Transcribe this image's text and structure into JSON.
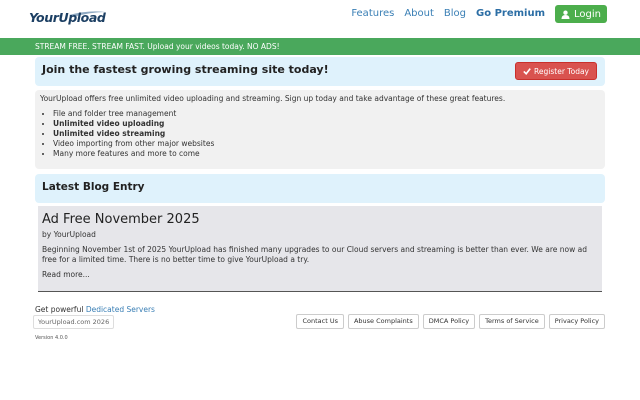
{
  "header": {
    "logo_text": "YourUpload",
    "nav": [
      "Features",
      "About",
      "Blog"
    ],
    "go_premium": "Go Premium",
    "login": "Login"
  },
  "banner": "STREAM FREE. STREAM FAST. Upload your videos today. NO ADS!",
  "hero": {
    "title": "Join the fastest growing streaming site today!",
    "register": "Register Today"
  },
  "features": {
    "intro": "YourUpload offers free unlimited video uploading and streaming. Sign up today and take advantage of these great features.",
    "items": [
      "File and folder tree management",
      "Unlimited video uploading",
      "Unlimited video streaming",
      "Video importing from other major websites",
      "Many more features and more to come"
    ]
  },
  "blog": {
    "heading": "Latest Blog Entry",
    "title": "Ad Free November 2025",
    "by": "by",
    "author": "YourUpload",
    "body": "Beginning November 1st of 2025 YourUpload has finished many upgrades to our Cloud servers and streaming is better than ever. We are now ad free for a limited time. There is no better time to give YourUpload a try.",
    "read_more": "Read more..."
  },
  "footer": {
    "powered_prefix": "Get powerful",
    "powered_link": "Dedicated Servers",
    "copyright": "YourUpload.com 2026",
    "version": "Version 4.0.0",
    "links": [
      "Contact Us",
      "Abuse Complaints",
      "DMCA Policy",
      "Terms of Service",
      "Privacy Policy"
    ]
  },
  "colors": {
    "banner_green": "#4aa85c",
    "login_green": "#4cae4c",
    "register_red": "#d9534f",
    "panel_blue": "#dff2fc",
    "link_blue": "#3a7fb5"
  }
}
